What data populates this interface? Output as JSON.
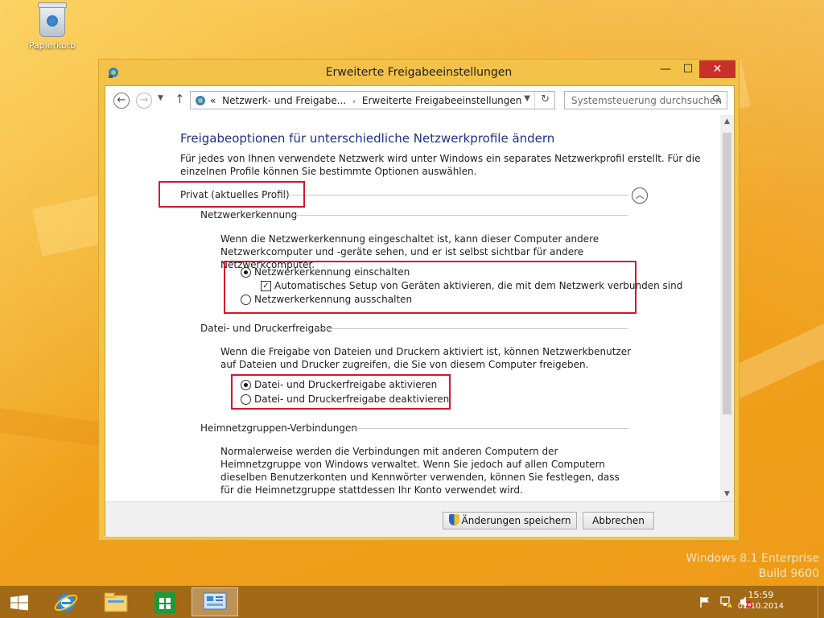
{
  "desktop": {
    "recycle_bin_label": "Papierkorb",
    "watermark_line1": "Windows 8.1 Enterprise",
    "watermark_line2": "Build 9600"
  },
  "window": {
    "title": "Erweiterte Freigabeeinstellungen",
    "controls": {
      "minimize": "—",
      "maximize": "☐",
      "close": "✕"
    }
  },
  "navbar": {
    "breadcrumb_prefix": "«",
    "breadcrumb_1": "Netzwerk- und Freigabe...",
    "breadcrumb_separator": "›",
    "breadcrumb_2": "Erweiterte Freigabeeinstellungen",
    "search_placeholder": "Systemsteuerung durchsuchen"
  },
  "content": {
    "heading": "Freigabeoptionen für unterschiedliche Netzwerkprofile ändern",
    "intro": "Für jedes von Ihnen verwendete Netzwerk wird unter Windows ein separates Netzwerkprofil erstellt. Für die einzelnen Profile können Sie bestimmte Optionen auswählen.",
    "profile_label": "Privat (aktuelles Profil)",
    "sections": {
      "discovery": {
        "title": "Netzwerkerkennung",
        "description": "Wenn die Netzwerkerkennung eingeschaltet ist, kann dieser Computer andere Netzwerkcomputer und -geräte sehen, und er ist selbst sichtbar für andere Netzwerkcomputer.",
        "option_on": "Netzwerkerkennung einschalten",
        "option_auto": "Automatisches Setup von Geräten aktivieren, die mit dem Netzwerk verbunden sind",
        "option_off": "Netzwerkerkennung ausschalten",
        "selected": "on",
        "auto_setup_checked": true
      },
      "file_sharing": {
        "title": "Datei- und Druckerfreigabe",
        "description": "Wenn die Freigabe von Dateien und Druckern aktiviert ist, können Netzwerkbenutzer auf Dateien und Drucker zugreifen, die Sie von diesem Computer freigeben.",
        "option_on": "Datei- und Druckerfreigabe aktivieren",
        "option_off": "Datei- und Druckerfreigabe deaktivieren",
        "selected": "on"
      },
      "homegroup": {
        "title": "Heimnetzgruppen-Verbindungen",
        "description": "Normalerweise werden die Verbindungen mit anderen Computern der Heimnetzgruppe von Windows verwaltet. Wenn Sie jedoch auf allen Computern dieselben Benutzerkonten und Kennwörter verwenden, können Sie festlegen, dass für die Heimnetzgruppe stattdessen Ihr Konto verwendet wird."
      }
    }
  },
  "footer": {
    "save_label": "Änderungen speichern",
    "cancel_label": "Abbrechen"
  },
  "taskbar": {
    "pinned": [
      "start-icon",
      "internet-explorer-icon",
      "file-explorer-icon",
      "store-icon",
      "control-panel-icon"
    ],
    "clock_time": "15:59",
    "clock_date": "02.10.2014"
  },
  "colors": {
    "accent_title": "#1e3287",
    "highlight_box": "#d8142b",
    "window_frame": "#f3c248",
    "close_button": "#c7302b"
  }
}
